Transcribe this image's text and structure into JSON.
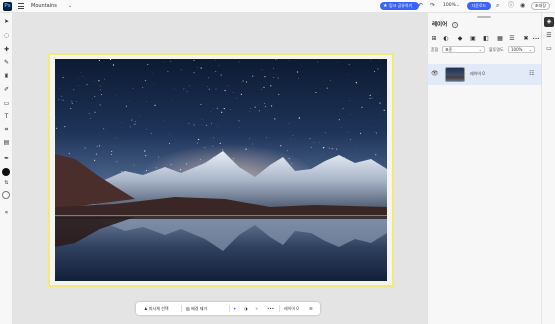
{
  "topbar": {
    "logo": "Ps",
    "document_name": "Mountains",
    "document_caret": "⌄",
    "share_label": "링크 공유하기",
    "zoom": "100%",
    "zoom_caret": "⌄",
    "download_label": "다운로드",
    "close_label": "초대장"
  },
  "tools": [
    "move-tool-icon",
    "quick-select-icon",
    "heal-icon",
    "brush-icon",
    "clone-stamp-icon",
    "eraser-icon",
    "rectangle-icon",
    "text-icon",
    "crop-icon",
    "gradient-icon",
    "eyedropper-icon",
    "swap-colors-icon",
    "collapse-toolbar-icon"
  ],
  "taskbar": {
    "select_subject": "피사체 선택",
    "remove_background": "배경 제거",
    "more": "•••",
    "layer_name": "레이어 0"
  },
  "panel": {
    "title": "레이어",
    "blend_label": "혼합",
    "blend_value": "표준",
    "opacity_label": "불투명도",
    "opacity_value": "100%",
    "more": "•••",
    "layers": [
      {
        "name": "레이어 0",
        "selected": true,
        "visible": true
      }
    ]
  },
  "colors": {
    "accent": "#3b63fb",
    "selection_frame": "#f2ea7c",
    "foreground": "#111111",
    "background": "#ffffff"
  }
}
